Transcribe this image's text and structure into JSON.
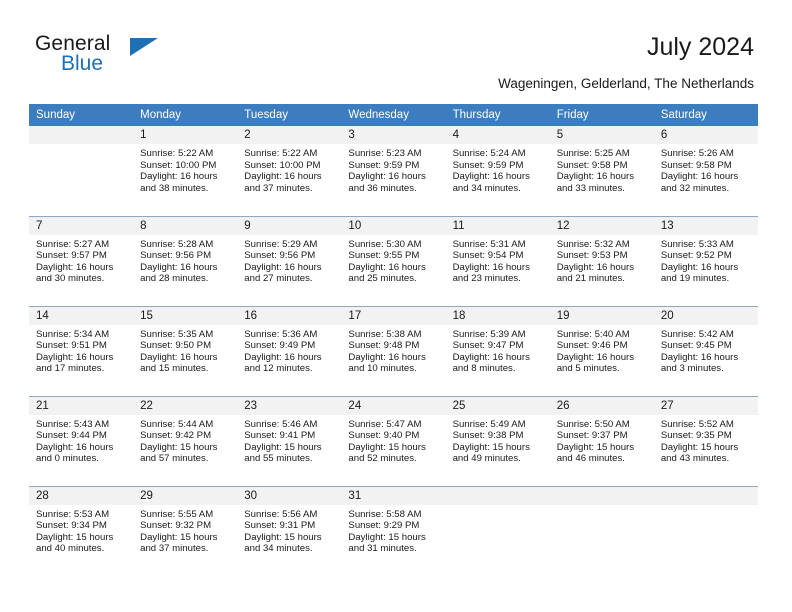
{
  "brand": {
    "word_one": "General",
    "word_two": "Blue",
    "accent_color": "#1f6fb5"
  },
  "header": {
    "title": "July 2024",
    "subtitle": "Wageningen, Gelderland, The Netherlands"
  },
  "calendar": {
    "header_bg": "#3b7dbf",
    "daynum_bg": "#f2f2f2",
    "weekday_headers": [
      "Sunday",
      "Monday",
      "Tuesday",
      "Wednesday",
      "Thursday",
      "Friday",
      "Saturday"
    ],
    "labels": {
      "sunrise": "Sunrise:",
      "sunset": "Sunset:",
      "daylight": "Daylight:"
    },
    "weeks": [
      [
        {
          "day": "",
          "sunrise": "",
          "sunset": "",
          "daylight_a": "",
          "daylight_b": ""
        },
        {
          "day": "1",
          "sunrise": "Sunrise: 5:22 AM",
          "sunset": "Sunset: 10:00 PM",
          "daylight_a": "Daylight: 16 hours",
          "daylight_b": "and 38 minutes."
        },
        {
          "day": "2",
          "sunrise": "Sunrise: 5:22 AM",
          "sunset": "Sunset: 10:00 PM",
          "daylight_a": "Daylight: 16 hours",
          "daylight_b": "and 37 minutes."
        },
        {
          "day": "3",
          "sunrise": "Sunrise: 5:23 AM",
          "sunset": "Sunset: 9:59 PM",
          "daylight_a": "Daylight: 16 hours",
          "daylight_b": "and 36 minutes."
        },
        {
          "day": "4",
          "sunrise": "Sunrise: 5:24 AM",
          "sunset": "Sunset: 9:59 PM",
          "daylight_a": "Daylight: 16 hours",
          "daylight_b": "and 34 minutes."
        },
        {
          "day": "5",
          "sunrise": "Sunrise: 5:25 AM",
          "sunset": "Sunset: 9:58 PM",
          "daylight_a": "Daylight: 16 hours",
          "daylight_b": "and 33 minutes."
        },
        {
          "day": "6",
          "sunrise": "Sunrise: 5:26 AM",
          "sunset": "Sunset: 9:58 PM",
          "daylight_a": "Daylight: 16 hours",
          "daylight_b": "and 32 minutes."
        }
      ],
      [
        {
          "day": "7",
          "sunrise": "Sunrise: 5:27 AM",
          "sunset": "Sunset: 9:57 PM",
          "daylight_a": "Daylight: 16 hours",
          "daylight_b": "and 30 minutes."
        },
        {
          "day": "8",
          "sunrise": "Sunrise: 5:28 AM",
          "sunset": "Sunset: 9:56 PM",
          "daylight_a": "Daylight: 16 hours",
          "daylight_b": "and 28 minutes."
        },
        {
          "day": "9",
          "sunrise": "Sunrise: 5:29 AM",
          "sunset": "Sunset: 9:56 PM",
          "daylight_a": "Daylight: 16 hours",
          "daylight_b": "and 27 minutes."
        },
        {
          "day": "10",
          "sunrise": "Sunrise: 5:30 AM",
          "sunset": "Sunset: 9:55 PM",
          "daylight_a": "Daylight: 16 hours",
          "daylight_b": "and 25 minutes."
        },
        {
          "day": "11",
          "sunrise": "Sunrise: 5:31 AM",
          "sunset": "Sunset: 9:54 PM",
          "daylight_a": "Daylight: 16 hours",
          "daylight_b": "and 23 minutes."
        },
        {
          "day": "12",
          "sunrise": "Sunrise: 5:32 AM",
          "sunset": "Sunset: 9:53 PM",
          "daylight_a": "Daylight: 16 hours",
          "daylight_b": "and 21 minutes."
        },
        {
          "day": "13",
          "sunrise": "Sunrise: 5:33 AM",
          "sunset": "Sunset: 9:52 PM",
          "daylight_a": "Daylight: 16 hours",
          "daylight_b": "and 19 minutes."
        }
      ],
      [
        {
          "day": "14",
          "sunrise": "Sunrise: 5:34 AM",
          "sunset": "Sunset: 9:51 PM",
          "daylight_a": "Daylight: 16 hours",
          "daylight_b": "and 17 minutes."
        },
        {
          "day": "15",
          "sunrise": "Sunrise: 5:35 AM",
          "sunset": "Sunset: 9:50 PM",
          "daylight_a": "Daylight: 16 hours",
          "daylight_b": "and 15 minutes."
        },
        {
          "day": "16",
          "sunrise": "Sunrise: 5:36 AM",
          "sunset": "Sunset: 9:49 PM",
          "daylight_a": "Daylight: 16 hours",
          "daylight_b": "and 12 minutes."
        },
        {
          "day": "17",
          "sunrise": "Sunrise: 5:38 AM",
          "sunset": "Sunset: 9:48 PM",
          "daylight_a": "Daylight: 16 hours",
          "daylight_b": "and 10 minutes."
        },
        {
          "day": "18",
          "sunrise": "Sunrise: 5:39 AM",
          "sunset": "Sunset: 9:47 PM",
          "daylight_a": "Daylight: 16 hours",
          "daylight_b": "and 8 minutes."
        },
        {
          "day": "19",
          "sunrise": "Sunrise: 5:40 AM",
          "sunset": "Sunset: 9:46 PM",
          "daylight_a": "Daylight: 16 hours",
          "daylight_b": "and 5 minutes."
        },
        {
          "day": "20",
          "sunrise": "Sunrise: 5:42 AM",
          "sunset": "Sunset: 9:45 PM",
          "daylight_a": "Daylight: 16 hours",
          "daylight_b": "and 3 minutes."
        }
      ],
      [
        {
          "day": "21",
          "sunrise": "Sunrise: 5:43 AM",
          "sunset": "Sunset: 9:44 PM",
          "daylight_a": "Daylight: 16 hours",
          "daylight_b": "and 0 minutes."
        },
        {
          "day": "22",
          "sunrise": "Sunrise: 5:44 AM",
          "sunset": "Sunset: 9:42 PM",
          "daylight_a": "Daylight: 15 hours",
          "daylight_b": "and 57 minutes."
        },
        {
          "day": "23",
          "sunrise": "Sunrise: 5:46 AM",
          "sunset": "Sunset: 9:41 PM",
          "daylight_a": "Daylight: 15 hours",
          "daylight_b": "and 55 minutes."
        },
        {
          "day": "24",
          "sunrise": "Sunrise: 5:47 AM",
          "sunset": "Sunset: 9:40 PM",
          "daylight_a": "Daylight: 15 hours",
          "daylight_b": "and 52 minutes."
        },
        {
          "day": "25",
          "sunrise": "Sunrise: 5:49 AM",
          "sunset": "Sunset: 9:38 PM",
          "daylight_a": "Daylight: 15 hours",
          "daylight_b": "and 49 minutes."
        },
        {
          "day": "26",
          "sunrise": "Sunrise: 5:50 AM",
          "sunset": "Sunset: 9:37 PM",
          "daylight_a": "Daylight: 15 hours",
          "daylight_b": "and 46 minutes."
        },
        {
          "day": "27",
          "sunrise": "Sunrise: 5:52 AM",
          "sunset": "Sunset: 9:35 PM",
          "daylight_a": "Daylight: 15 hours",
          "daylight_b": "and 43 minutes."
        }
      ],
      [
        {
          "day": "28",
          "sunrise": "Sunrise: 5:53 AM",
          "sunset": "Sunset: 9:34 PM",
          "daylight_a": "Daylight: 15 hours",
          "daylight_b": "and 40 minutes."
        },
        {
          "day": "29",
          "sunrise": "Sunrise: 5:55 AM",
          "sunset": "Sunset: 9:32 PM",
          "daylight_a": "Daylight: 15 hours",
          "daylight_b": "and 37 minutes."
        },
        {
          "day": "30",
          "sunrise": "Sunrise: 5:56 AM",
          "sunset": "Sunset: 9:31 PM",
          "daylight_a": "Daylight: 15 hours",
          "daylight_b": "and 34 minutes."
        },
        {
          "day": "31",
          "sunrise": "Sunrise: 5:58 AM",
          "sunset": "Sunset: 9:29 PM",
          "daylight_a": "Daylight: 15 hours",
          "daylight_b": "and 31 minutes."
        },
        {
          "day": "",
          "sunrise": "",
          "sunset": "",
          "daylight_a": "",
          "daylight_b": ""
        },
        {
          "day": "",
          "sunrise": "",
          "sunset": "",
          "daylight_a": "",
          "daylight_b": ""
        },
        {
          "day": "",
          "sunrise": "",
          "sunset": "",
          "daylight_a": "",
          "daylight_b": ""
        }
      ]
    ]
  }
}
